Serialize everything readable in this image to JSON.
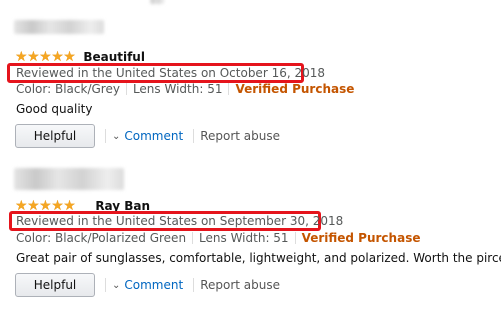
{
  "colors": {
    "star": "#f5a623",
    "verified": "#c45500",
    "link": "#0066c0",
    "highlight_border": "#e5141c",
    "muted_text": "#565959"
  },
  "reviews": [
    {
      "rating": 5,
      "title": "Beautiful",
      "date": "Reviewed in the United States on October 16, 2018",
      "color_label": "Color: Black/Grey",
      "lens_label": "Lens Width: 51",
      "verified": "Verified Purchase",
      "body": "Good quality",
      "helpful_label": "Helpful",
      "comment_label": "Comment",
      "report_label": "Report abuse"
    },
    {
      "rating": 5,
      "title": "Ray Ban",
      "date": "Reviewed in the United States on September 30, 2018",
      "color_label": "Color: Black/Polarized Green",
      "lens_label": "Lens Width: 51",
      "verified": "Verified Purchase",
      "body": "Great pair of sunglasses, comfortable, lightweight, and polarized. Worth the pirce",
      "helpful_label": "Helpful",
      "comment_label": "Comment",
      "report_label": "Report abuse"
    }
  ],
  "icons": {
    "star": "star-icon",
    "caret": "caret-down-icon"
  }
}
